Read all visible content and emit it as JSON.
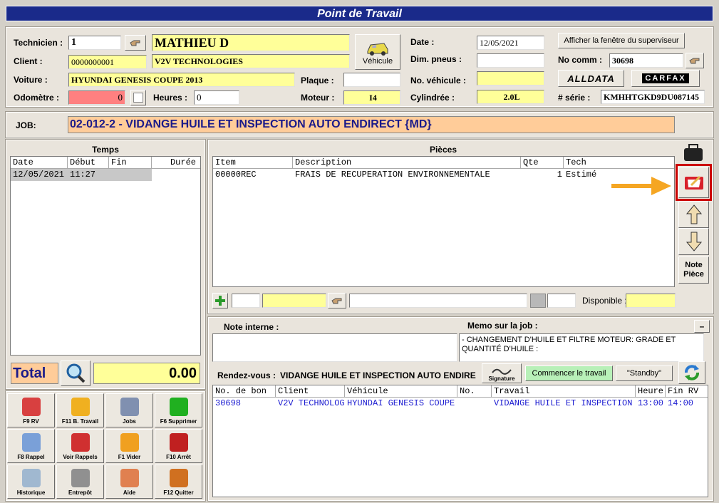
{
  "window": {
    "title": "Point de Travail"
  },
  "header": {
    "technicien_label": "Technicien :",
    "technicien_value": "1",
    "technicien_name": "MATHIEU D",
    "client_label": "Client :",
    "client_value": "0000000001",
    "client_name": "V2V TECHNOLOGIES",
    "voiture_label": "Voiture :",
    "voiture_value": "HYUNDAI GENESIS COUPE 2013",
    "odometre_label": "Odomètre :",
    "odometre_value": "0",
    "heures_label": "Heures :",
    "heures_value": "0",
    "vehicule_button": "Véhicule",
    "plaque_label": "Plaque :",
    "plaque_value": "",
    "moteur_label": "Moteur :",
    "moteur_value": "I4",
    "date_label": "Date :",
    "date_value": "12/05/2021",
    "dim_pneus_label": "Dim. pneus :",
    "dim_pneus_value": "",
    "no_vehicule_label": "No. véhicule :",
    "no_vehicule_value": "",
    "cylindree_label": "Cylindrée :",
    "cylindree_value": "2.0L",
    "superviseur_button": "Afficher la fenêtre du superviseur",
    "no_comm_label": "No comm :",
    "no_comm_value": "30698",
    "alldata_label": "ALLDATA",
    "carfax_label": "CARFAX",
    "serie_label": "# série :",
    "serie_value": "KMHHTGKD9DU087145"
  },
  "job": {
    "label": "JOB:",
    "value": "02-012-2 - VIDANGE HUILE ET INSPECTION AUTO ENDIRECT {MD}"
  },
  "temps": {
    "title": "Temps",
    "columns": [
      "Date",
      "Début",
      "Fin",
      "Durée"
    ],
    "rows": [
      {
        "date": "12/05/2021",
        "debut": "11:27",
        "fin": "",
        "duree": ""
      }
    ],
    "total_label": "Total",
    "total_value": "0.00"
  },
  "pieces": {
    "title": "Pièces",
    "columns": [
      "Item",
      "Description",
      "Qte",
      "Tech"
    ],
    "rows": [
      {
        "item": "00000REC",
        "description": "FRAIS DE RECUPERATION ENVIRONNEMENTALE",
        "qte": "1",
        "tech": "Estimé"
      }
    ],
    "disponible_label": "Disponible :",
    "note_piece_label": "Note\nPièce"
  },
  "notes": {
    "note_interne_label": "Note interne :",
    "memo_label": "Memo sur la job :",
    "memo_text": "- CHANGEMENT D'HUILE ET FILTRE MOTEUR:  GRADE ET QUANTITÉ D'HUILE :",
    "collapse_label": "–"
  },
  "rendezvous": {
    "label": "Rendez-vous :",
    "value": "VIDANGE HUILE ET INSPECTION AUTO ENDIRE",
    "signature_label": "Signature",
    "commencer_button": "Commencer le travail",
    "standby_button": "\"Standby\"",
    "columns": [
      "No. de bon",
      "Client",
      "Véhicule",
      "No.",
      "Travail",
      "Heure",
      "Fin RV"
    ],
    "rows": [
      {
        "bon": "30698",
        "client": "V2V TECHNOLOG",
        "vehicule": "HYUNDAI GENESIS COUPE",
        "no": "",
        "travail": "VIDANGE HUILE ET INSPECTION",
        "heure": "13:00",
        "fin": "14:00"
      }
    ]
  },
  "toolbar": {
    "tiles": [
      {
        "label": "F9 RV",
        "icon": "calendar-icon"
      },
      {
        "label": "F11 B. Travail",
        "icon": "worksheet-icon"
      },
      {
        "label": "Jobs",
        "icon": "tools-icon"
      },
      {
        "label": "F6 Supprimer",
        "icon": "minus-icon"
      },
      {
        "label": "F8 Rappel",
        "icon": "notepad-icon"
      },
      {
        "label": "Voir Rappels",
        "icon": "phone-icon"
      },
      {
        "label": "F1 Vider",
        "icon": "undo-arrow-icon"
      },
      {
        "label": "F10 Arrêt",
        "icon": "stop-icon"
      },
      {
        "label": "Historique",
        "icon": "hourglass-icon"
      },
      {
        "label": "Entrepôt",
        "icon": "warehouse-icon"
      },
      {
        "label": "Aide",
        "icon": "help-person-icon"
      },
      {
        "label": "F12 Quitter",
        "icon": "exit-door-icon"
      }
    ]
  },
  "colors": {
    "title_bar": "#1a2a8a",
    "highlight": "#ffff99",
    "job_bar": "#ffcc99",
    "odometer": "#ff8080",
    "annotation_arrow": "#f5a623",
    "annotation_box": "#cc0000"
  }
}
